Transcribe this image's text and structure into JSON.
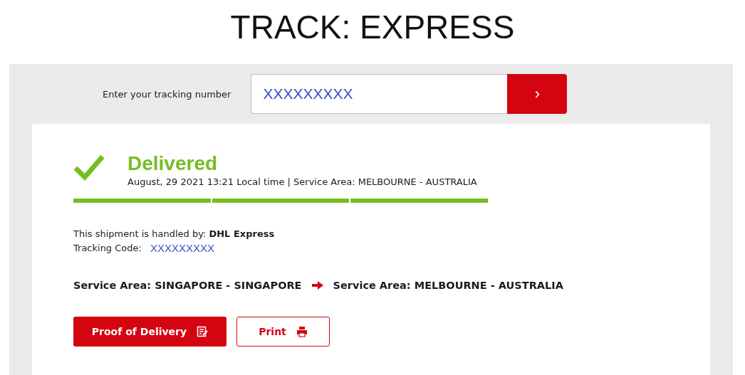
{
  "title": "TRACK: EXPRESS",
  "search": {
    "label": "Enter your tracking number",
    "value": "XXXXXXXXX",
    "submit": "›"
  },
  "status": {
    "kind": "delivered",
    "heading": "Delivered",
    "detail": "August, 29 2021 13:21 Local time | Service Area: MELBOURNE - AUSTRALIA"
  },
  "progress": [
    {
      "filled": true
    },
    {
      "filled": true
    },
    {
      "filled": true
    }
  ],
  "handled_by": "This shipment is handled by: **DHL Express**",
  "tracking_code": {
    "label": "Tracking Code:",
    "value": "XXXXXXXXX"
  },
  "route": {
    "origin": "Service Area: SINGAPORE - SINGAPORE",
    "destination": "Service Area: MELBOURNE - AUSTRALIA"
  },
  "buttons": [
    {
      "label": "Proof of Delivery",
      "kind": "primary"
    },
    {
      "label": "Print",
      "kind": "secondary"
    }
  ]
}
